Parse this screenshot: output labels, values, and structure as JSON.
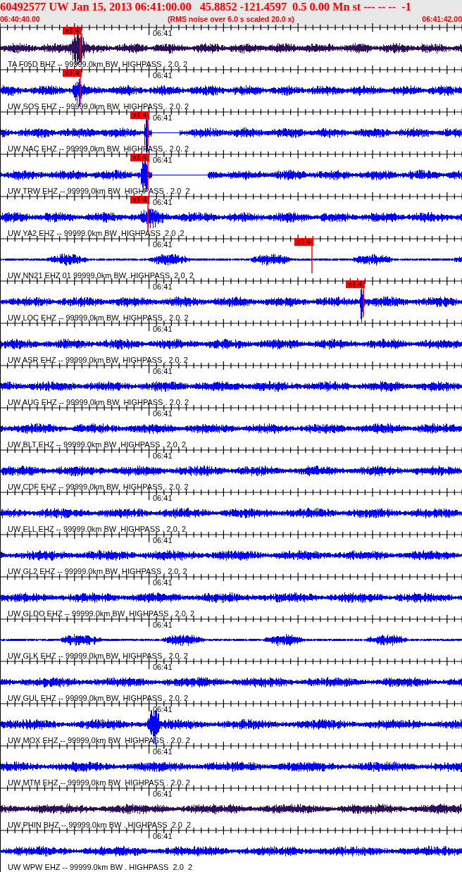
{
  "header": {
    "title": "60492577 UW Jan 15, 2013 06:41:00.00   45.8852 -121.4597  0.5 0.00 Mn st --- -- --  -1",
    "start_time": "06:40:40.00",
    "note": "(RMS noise over 6.0 s scaled 20.0 x)",
    "end_time": "06:41:42.00"
  },
  "traces": [
    {
      "label": "TA F05D BHZ -- 99999.0km BW  HIGHPASS . 2.0. 2",
      "time_label": "06:41",
      "color": "#2e0f5c",
      "pick": "xT 4"
    },
    {
      "label": "UW SOS EHZ -- 99999.0km BW  HIGHPASS . 2.0. 2",
      "time_label": "06:41",
      "color": "#0000ff",
      "pick": "xT 4"
    },
    {
      "label": "UW NAC EHZ -- 99999.0km BW  HIGHPASS . 2.0. 2",
      "time_label": "06:41",
      "color": "#0000ff",
      "pick": "xT 4"
    },
    {
      "label": "UW TRW EHZ -- 99999.0km BW  HIGHPASS . 2.0  2",
      "time_label": "06:41",
      "color": "#0000ff",
      "pick": "xT 4"
    },
    {
      "label": "UW YA2 EHZ -- 99999.0km BW  HIGHPASS  2.0 .2",
      "time_label": "06:41",
      "color": "#0000ff",
      "pick": "xT 4"
    },
    {
      "label": "UW NN21 EHZ 01 99999.0km BW .HIGHPASS. 2.0  2",
      "time_label": "06:41",
      "color": "#0000ff",
      "pick": "xT 4"
    },
    {
      "label": "UW LOC EHZ -- 99999.0km BW  HIGHPASS . 2.0. 2",
      "time_label": "06:41",
      "color": "#0000ff",
      "pick": "xT 4"
    },
    {
      "label": "UW ASR EHZ -- 99999.0km BW  HIGHPASS . 2.0. 2",
      "time_label": "06:41",
      "color": "#0000ff"
    },
    {
      "label": "UW AUG EHZ -- 99999.0km BW  HIGHPASS . 2.0. 2",
      "time_label": "06:41",
      "color": "#0000ff"
    },
    {
      "label": "UW BLT EHZ -- 99999.0km BW  HIGHPASS . 2.0. 2",
      "time_label": "06:41",
      "color": "#0000ff"
    },
    {
      "label": "UW CDF EHZ -- 99999.0km BW  HIGHPASS . 2.0. 2",
      "time_label": "06:41",
      "color": "#0000ff"
    },
    {
      "label": "UW ELL EHZ -- 99999.0km BW  HIGHPASS . 2.0. 2",
      "time_label": "06:41",
      "color": "#0000ff"
    },
    {
      "label": "UW GL2 EHZ -- 99999.0km BW  HIGHPASS . 2.0. 2",
      "time_label": "06:41",
      "color": "#0000ff"
    },
    {
      "label": "UW GLDO EHZ -- 99999.0km BW  HIGHPASS . 2.0. 2",
      "time_label": "06:41",
      "color": "#0000ff"
    },
    {
      "label": "UW GLK EHZ -- 99999.0km BW  HIGHPASS . 2.0. 2",
      "time_label": "06:41",
      "color": "#0000ff"
    },
    {
      "label": "UW GUL EHZ -- 99999.0km BW  HIGHPASS . 2.0. 2",
      "time_label": "06:41",
      "color": "#0000ff"
    },
    {
      "label": "UW MOX EHZ -- 99999.0km BW  HIGHPASS . 2.0. 2",
      "time_label": "06:41",
      "color": "#0000ff"
    },
    {
      "label": "UW MTM EHZ -- 99999.0km BW  HIGHPASS . 2.0. 2",
      "time_label": "06:41",
      "color": "#0000ff"
    },
    {
      "label": "UW PHIN BHZ -- 99999.0km BW . HIGHPASS  2.0  2",
      "time_label": "06:41",
      "color": "#2e0f5c"
    },
    {
      "label": "UW WPW EHZ -- 99999.0km BW . HIGHPASS  2.0  2",
      "time_label": "06:41",
      "color": "#0000ff"
    }
  ]
}
